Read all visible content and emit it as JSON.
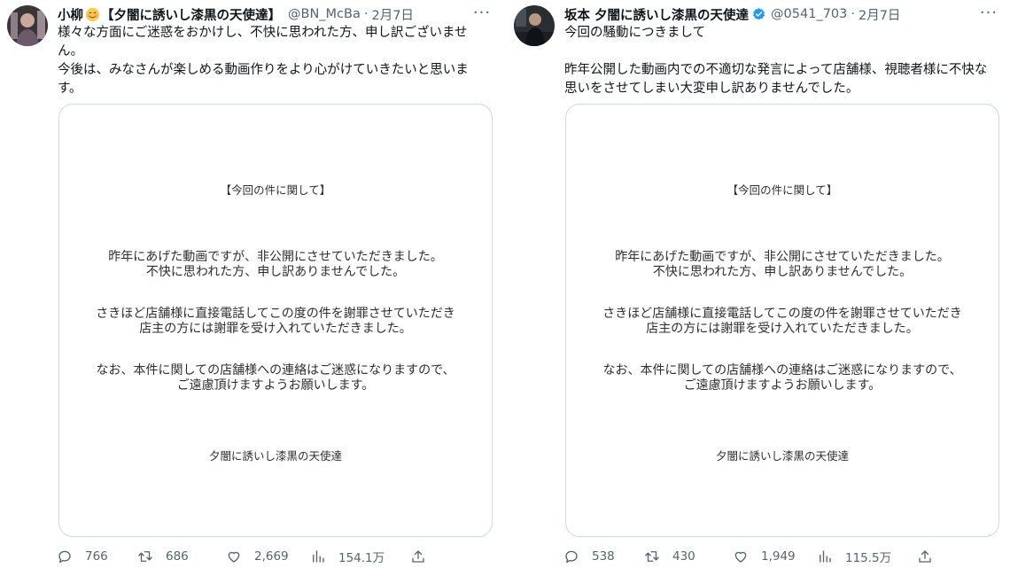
{
  "tweets": [
    {
      "name": "小柳",
      "name_suffix": "【夕闇に誘いし漆黒の天使達】",
      "handle": "@BN_McBa",
      "date": "2月7日",
      "body": [
        "様々な方面にご迷惑をおかけし、不快に思われた方、申し訳ございません。",
        "",
        "今後は、みなさんが楽しめる動画作りをより心がけていきたいと思います。"
      ],
      "card": {
        "title": "【今回の件に関して】",
        "p1": [
          "昨年にあげた動画ですが、非公開にさせていただきました。",
          "不快に思われた方、申し訳ありませんでした。"
        ],
        "p2": [
          "さきほど店舗様に直接電話してこの度の件を謝罪させていただき",
          "店主の方には謝罪を受け入れていただきました。"
        ],
        "p3": [
          "なお、本件に関しての店舗様への連絡はご迷惑になりますので、",
          "ご遠慮頂けますようお願いします。"
        ],
        "signature": "夕闇に誘いし漆黒の天使達"
      },
      "stats": {
        "replies": "766",
        "retweets": "686",
        "likes": "2,669",
        "views": "154.1万"
      }
    },
    {
      "name": "坂本 夕闇に誘いし漆黒の天使達",
      "handle": "@0541_703",
      "date": "2月7日",
      "body": [
        "今回の騒動につきまして",
        "",
        "昨年公開した動画内での不適切な発言によって店舗様、視聴者様に不快な思いをさせてしまい大変申し訳ありませんでした。"
      ],
      "card": {
        "title": "【今回の件に関して】",
        "p1": [
          "昨年にあげた動画ですが、非公開にさせていただきました。",
          "不快に思われた方、申し訳ありませんでした。"
        ],
        "p2": [
          "さきほど店舗様に直接電話してこの度の件を謝罪させていただき",
          "店主の方には謝罪を受け入れていただきました。"
        ],
        "p3": [
          "なお、本件に関しての店舗様への連絡はご迷惑になりますので、",
          "ご遠慮頂けますようお願いします。"
        ],
        "signature": "夕闇に誘いし漆黒の天使達"
      },
      "stats": {
        "replies": "538",
        "retweets": "430",
        "likes": "1,949",
        "views": "115.5万"
      }
    }
  ],
  "ui": {
    "separator": "·",
    "more_glyph": "···"
  },
  "colors": {
    "text": "#0f1419",
    "muted": "#536471",
    "border": "#cfd9de",
    "verified": "#1d9bf0"
  },
  "icons": [
    "reply-icon",
    "retweet-icon",
    "like-icon",
    "views-icon",
    "share-icon",
    "verified-badge-icon",
    "smiling-face-emoji-icon",
    "more-icon"
  ]
}
